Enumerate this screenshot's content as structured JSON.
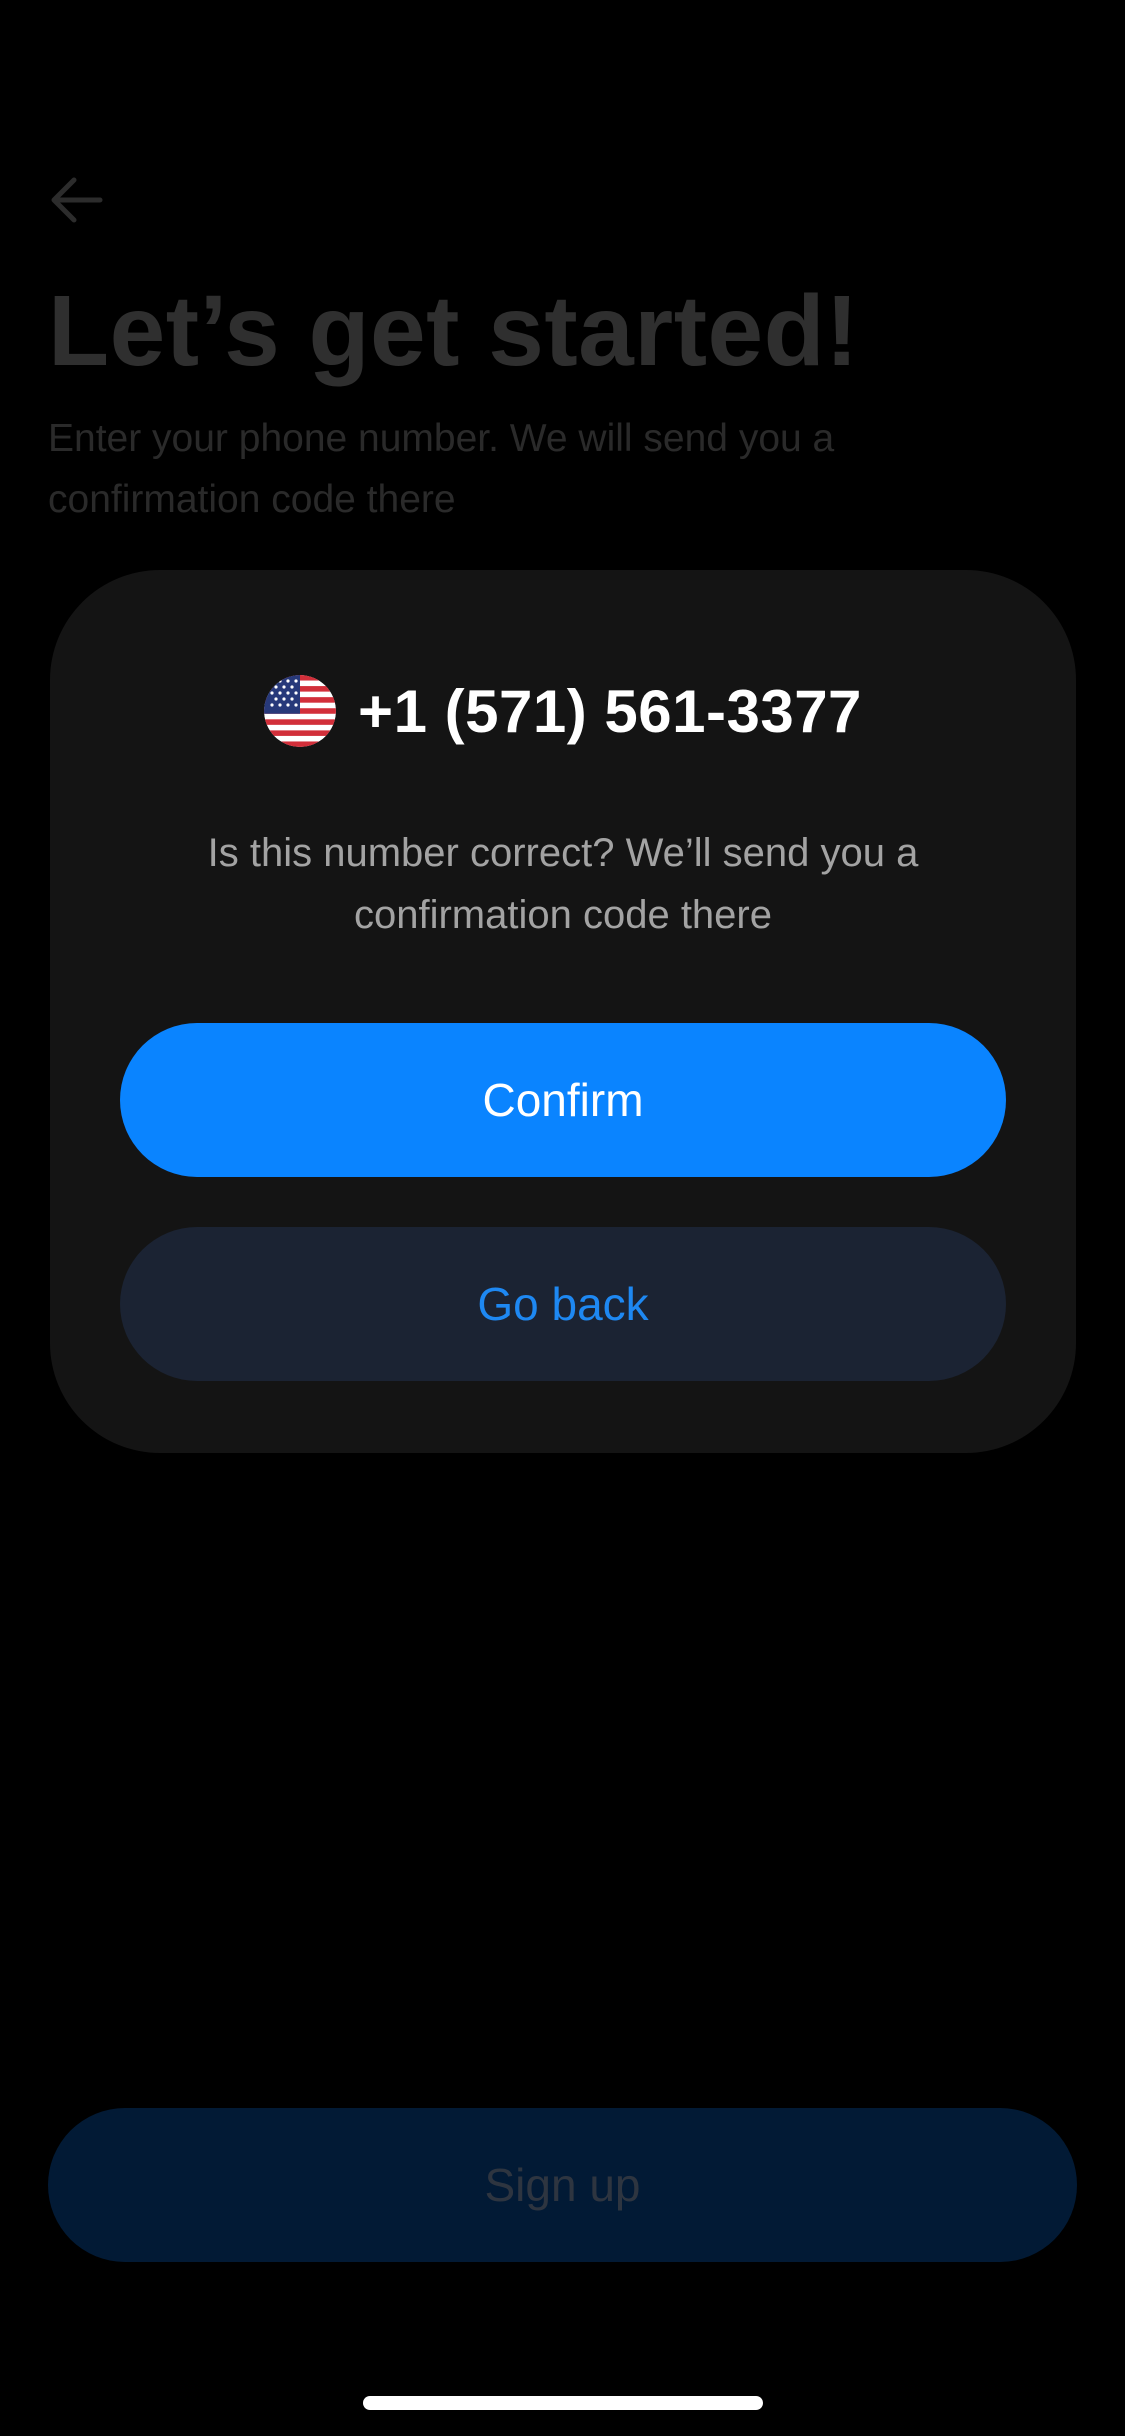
{
  "background_screen": {
    "back_icon": "arrow-left-icon",
    "title": "Let’s get started!",
    "subtitle": "Enter your phone number. We will send you a confirmation code there",
    "signup_label": "Sign up"
  },
  "confirm_dialog": {
    "country_flag_icon": "us-flag-icon",
    "phone_number": "+1 (571) 561-3377",
    "message": "Is this number correct? We’ll send you a confirmation code there",
    "confirm_label": "Confirm",
    "go_back_label": "Go back"
  },
  "colors": {
    "background": "#000000",
    "modal_background": "#141414",
    "primary_button": "#0a84ff",
    "secondary_button": "#1b2333",
    "secondary_button_text": "#1e88f2",
    "dimmed_signup_button": "#021a35"
  }
}
